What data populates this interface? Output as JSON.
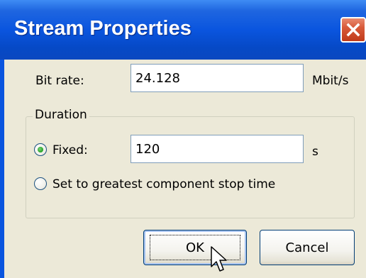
{
  "window": {
    "title": "Stream Properties"
  },
  "bitrate": {
    "label": "Bit rate:",
    "value": "24.128",
    "unit": "Mbit/s"
  },
  "duration": {
    "group_label": "Duration",
    "fixed_label": "Fixed:",
    "fixed_value": "120",
    "fixed_unit": "s",
    "fixed_selected": true,
    "greatest_label": "Set to greatest component stop time",
    "greatest_selected": false
  },
  "buttons": {
    "ok_label": "OK",
    "cancel_label": "Cancel"
  },
  "icons": {
    "close": "close-icon",
    "cursor": "mouse-cursor-icon"
  },
  "colors": {
    "titlebar": "#0a55df",
    "dialog_bg": "#ece9d8",
    "close_button": "#d85a3a"
  }
}
